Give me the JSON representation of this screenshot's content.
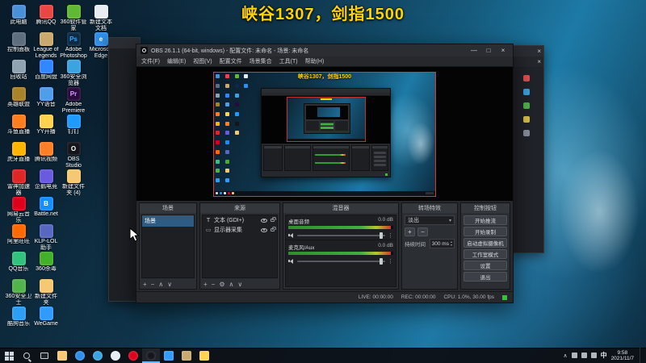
{
  "overlay": {
    "title": "峡谷1307，剑指1500",
    "title_color": "#ffd400"
  },
  "desktop": {
    "icons": [
      {
        "col": 0,
        "row": 0,
        "label": "此电脑",
        "color": "#4a90d9"
      },
      {
        "col": 0,
        "row": 1,
        "label": "控制面板",
        "color": "#5e6e7e"
      },
      {
        "col": 0,
        "row": 2,
        "label": "回收站",
        "color": "#8fa3b0"
      },
      {
        "col": 0,
        "row": 3,
        "label": "英雄联盟",
        "color": "#a8832a"
      },
      {
        "col": 0,
        "row": 4,
        "label": "斗鱼直播",
        "color": "#ff7d1a"
      },
      {
        "col": 0,
        "row": 5,
        "label": "虎牙直播",
        "color": "#ffb400"
      },
      {
        "col": 0,
        "row": 6,
        "label": "雷神加速器",
        "color": "#e02525"
      },
      {
        "col": 0,
        "row": 7,
        "label": "网易云音乐",
        "color": "#dd001b"
      },
      {
        "col": 0,
        "row": 8,
        "label": "阿里旺旺",
        "color": "#ff6a00"
      },
      {
        "col": 0,
        "row": 9,
        "label": "QQ音乐",
        "color": "#31c27c"
      },
      {
        "col": 0,
        "row": 10,
        "label": "360安全卫士",
        "color": "#52b54b"
      },
      {
        "col": 0,
        "row": 11,
        "label": "酷狗音乐",
        "color": "#2c9ef4"
      },
      {
        "col": 1,
        "row": 0,
        "label": "腾讯QQ",
        "color": "#eb4545"
      },
      {
        "col": 1,
        "row": 1,
        "label": "League of Legends",
        "color": "#c8aa6e"
      },
      {
        "col": 1,
        "row": 2,
        "label": "百度网盘",
        "color": "#2f88ff"
      },
      {
        "col": 1,
        "row": 3,
        "label": "YY语音",
        "color": "#4f9ee8"
      },
      {
        "col": 1,
        "row": 4,
        "label": "YY开播",
        "color": "#ffd34d"
      },
      {
        "col": 1,
        "row": 5,
        "label": "腾讯视频",
        "color": "#ff7f24"
      },
      {
        "col": 1,
        "row": 6,
        "label": "企鹅电竞",
        "color": "#6a5ae0"
      },
      {
        "col": 1,
        "row": 7,
        "label": "Battle.net",
        "color": "#148eff",
        "glyph": "B"
      },
      {
        "col": 1,
        "row": 8,
        "label": "KLP-LOL助手",
        "color": "#5868c0"
      },
      {
        "col": 1,
        "row": 9,
        "label": "360杀毒",
        "color": "#43b02a"
      },
      {
        "col": 1,
        "row": 10,
        "label": "新建文件夹",
        "color": "#f7c873"
      },
      {
        "col": 1,
        "row": 11,
        "label": "WeGame",
        "color": "#2f9bff"
      },
      {
        "col": 2,
        "row": 0,
        "label": "360软件管家",
        "color": "#61b832"
      },
      {
        "col": 2,
        "row": 1,
        "label": "Adobe Photoshop",
        "color": "#0b2a44",
        "glyph": "Ps",
        "glyph_color": "#31a8ff"
      },
      {
        "col": 2,
        "row": 2,
        "label": "360安全浏览器",
        "color": "#3aa4e0"
      },
      {
        "col": 2,
        "row": 3,
        "label": "Adobe Premiere",
        "color": "#2a0a3c",
        "glyph": "Pr",
        "glyph_color": "#d6a1ff"
      },
      {
        "col": 2,
        "row": 4,
        "label": "钉钉",
        "color": "#1e9bff"
      },
      {
        "col": 2,
        "row": 5,
        "label": "OBS Studio",
        "color": "#14141b",
        "glyph": "O"
      },
      {
        "col": 2,
        "row": 6,
        "label": "新建文件夹 (4)",
        "color": "#f7c873"
      },
      {
        "col": 3,
        "row": 0,
        "label": "新建文本文档",
        "color": "#e9edf2"
      },
      {
        "col": 3,
        "row": 1,
        "label": "Microsoft Edge",
        "color": "#2f8fe8",
        "glyph": "e"
      }
    ]
  },
  "obs": {
    "window_title": "OBS 26.1.1 (64-bit, windows) - 配置文件: 未命名 - 场景: 未命名",
    "window_buttons": {
      "minimize": "—",
      "maximize": "□",
      "close": "×"
    },
    "menu": [
      "文件(F)",
      "编辑(E)",
      "视图(V)",
      "配置文件",
      "场景集合",
      "工具(T)",
      "帮助(H)"
    ],
    "scenes": {
      "title": "场景",
      "items": [
        "场景"
      ],
      "toolbar": [
        "+",
        "−",
        "∧",
        "∨"
      ]
    },
    "sources": {
      "title": "来源",
      "items": [
        {
          "icon": "text",
          "glyph": "T",
          "label": "文本 (GDI+)"
        },
        {
          "icon": "display-capture",
          "glyph": "▭",
          "label": "显示器采集"
        }
      ],
      "toolbar": [
        "+",
        "−",
        "⚙",
        "∧",
        "∨"
      ]
    },
    "mixer": {
      "title": "混音器",
      "channels": [
        {
          "name": "桌面音频",
          "db": "0.0 dB"
        },
        {
          "name": "麦克风/Aux",
          "db": "0.0 dB"
        }
      ]
    },
    "transitions": {
      "title": "转场特效",
      "selected": "淡出",
      "combo_arrow": "▾",
      "buttons": [
        "+",
        "−"
      ],
      "duration_label": "持续时间",
      "duration_value": "300 ms",
      "spin_up": "▴",
      "spin_down": "▾"
    },
    "controls": {
      "title": "控制按钮",
      "buttons": [
        "开始推流",
        "开始录制",
        "启动虚拟摄像机",
        "工作室模式",
        "设置",
        "退出"
      ]
    },
    "status": [
      "LIVE: 00:00:00",
      "REC: 00:00:00",
      "CPU: 1.0%, 30.00 fps"
    ]
  },
  "right_window": {
    "close": "×"
  },
  "taskbar": {
    "items": [
      {
        "name": "start",
        "kind": "start"
      },
      {
        "name": "search",
        "kind": "search"
      },
      {
        "name": "task-view",
        "kind": "taskview"
      },
      {
        "name": "file-explorer",
        "color": "#f7c873"
      },
      {
        "name": "edge",
        "color": "#2f8fe8",
        "round": true
      },
      {
        "name": "browser-360",
        "color": "#3aa4e0",
        "round": true
      },
      {
        "name": "qq",
        "color": "#e8eef5",
        "round": true
      },
      {
        "name": "netease-music",
        "color": "#dd001b",
        "round": true
      },
      {
        "name": "obs-studio",
        "color": "#15151c",
        "round": true,
        "active": true
      },
      {
        "name": "wegame",
        "color": "#2f9bff"
      },
      {
        "name": "league-of-legends",
        "color": "#c8aa6e"
      },
      {
        "name": "yy",
        "color": "#ffd34d"
      }
    ],
    "tray": {
      "expand": "∧",
      "ime": "中",
      "time": "9:58",
      "date": "2021/11/7"
    }
  }
}
